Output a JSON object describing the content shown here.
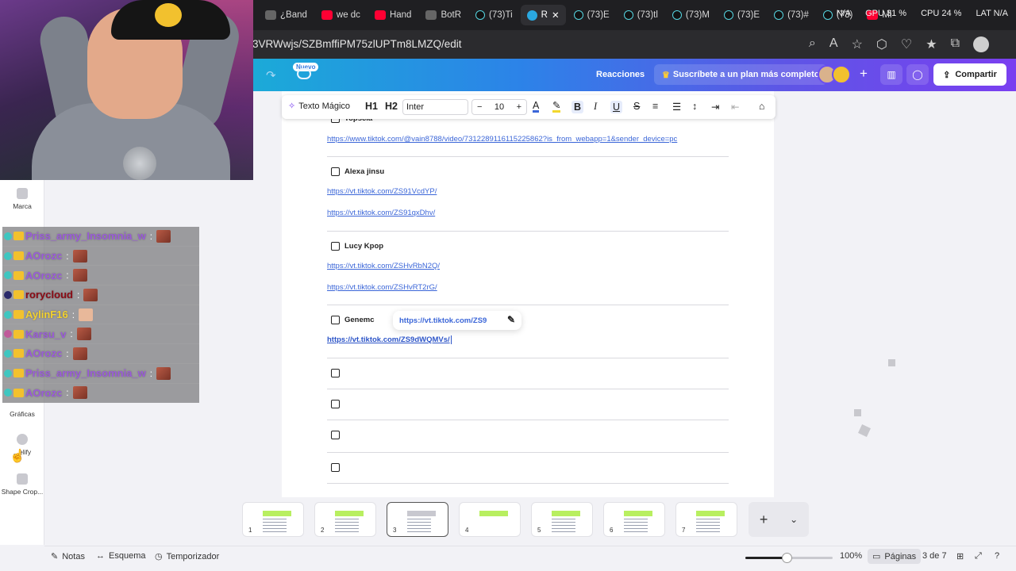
{
  "browser": {
    "tabs": [
      {
        "label": "¿Band",
        "icon": "grey"
      },
      {
        "label": "we dc",
        "icon": "yt"
      },
      {
        "label": "Hand",
        "icon": "yt"
      },
      {
        "label": "BotR",
        "icon": "grey"
      },
      {
        "label": "(73)Ti",
        "icon": "tt"
      },
      {
        "label": "R",
        "icon": "canva",
        "active": true
      },
      {
        "label": "(73)E",
        "icon": "tt"
      },
      {
        "label": "(73)tl",
        "icon": "tt"
      },
      {
        "label": "(73)M",
        "icon": "tt"
      },
      {
        "label": "(73)E",
        "icon": "tt"
      },
      {
        "label": "(73)#",
        "icon": "tt"
      },
      {
        "label": "(73)",
        "icon": "tt"
      },
      {
        "label": "Mi",
        "icon": "yt"
      }
    ],
    "stats": {
      "gpu": "GPU 31 %",
      "cpu": "CPU 24 %",
      "extra": "N/A",
      "lat": "LAT N/A"
    },
    "url": "3VRWwjs/SZBmffiPM75zlUPTm8LMZQ/edit"
  },
  "header": {
    "nuevo": "Nuevo",
    "reacciones": "Reacciones",
    "subscribe": "Suscríbete a un plan más completo",
    "share": "Compartir"
  },
  "toolbar": {
    "magic": "Texto Mágico",
    "h1": "H1",
    "h2": "H2",
    "font": "Inter",
    "size": "10",
    "minus": "−",
    "plus": "+"
  },
  "tools": [
    {
      "label": "Marca"
    },
    {
      "label": "Gráficas"
    },
    {
      "label": "...elify"
    },
    {
      "label": "Shape Crop..."
    }
  ],
  "chat": [
    {
      "name": "Priss_army_Insomnia_w",
      "color": "#9a5bd8"
    },
    {
      "name": "AOrozc",
      "color": "#9a5bd8"
    },
    {
      "name": "AOrozc",
      "color": "#9a5bd8"
    },
    {
      "name": "rorycloud",
      "color": "#8a0a14"
    },
    {
      "name": "AylinF16",
      "color": "#f2d12e"
    },
    {
      "name": "Karsu_v",
      "color": "#9a5bd8"
    },
    {
      "name": "AOrozc",
      "color": "#9a5bd8"
    },
    {
      "name": "Priss_army_Insomnia_w",
      "color": "#9a5bd8"
    },
    {
      "name": "AOrozc",
      "color": "#9a5bd8"
    }
  ],
  "doc": {
    "section0": {
      "title": "Topscia",
      "link": "https://www.tiktok.com/@vain8788/video/7312289116115225862?is_from_webapp=1&sender_device=pc"
    },
    "section1": {
      "title": "Alexa jinsu",
      "links": [
        "https://vt.tiktok.com/ZS91VcdYP/",
        "https://vt.tiktok.com/ZS91qxDhv/"
      ]
    },
    "section2": {
      "title": "Lucy Kpop",
      "links": [
        "https://vt.tiktok.com/ZSHvRbN2Q/",
        "https://vt.tiktok.com/ZSHvRT2rG/"
      ]
    },
    "section3": {
      "title": "Genemc",
      "link": "https://vt.tiktok.com/ZS9dWQMVs/",
      "popup": "https://vt.tiktok.com/ZS9"
    }
  },
  "pages": [
    {
      "num": "1"
    },
    {
      "num": "2"
    },
    {
      "num": "3",
      "active": true
    },
    {
      "num": "4"
    },
    {
      "num": "5"
    },
    {
      "num": "6"
    },
    {
      "num": "7"
    }
  ],
  "footer": {
    "notes": "Notas",
    "outline": "Esquema",
    "timer": "Temporizador",
    "zoom": "100%",
    "zoom_fraction": 0.47,
    "pages": "Páginas",
    "page_of": "3 de 7"
  },
  "colors": {
    "link": "#3b66d8",
    "accent": "#7a3ff0",
    "header_start": "#1baad8",
    "header_end": "#7a3ff0"
  }
}
